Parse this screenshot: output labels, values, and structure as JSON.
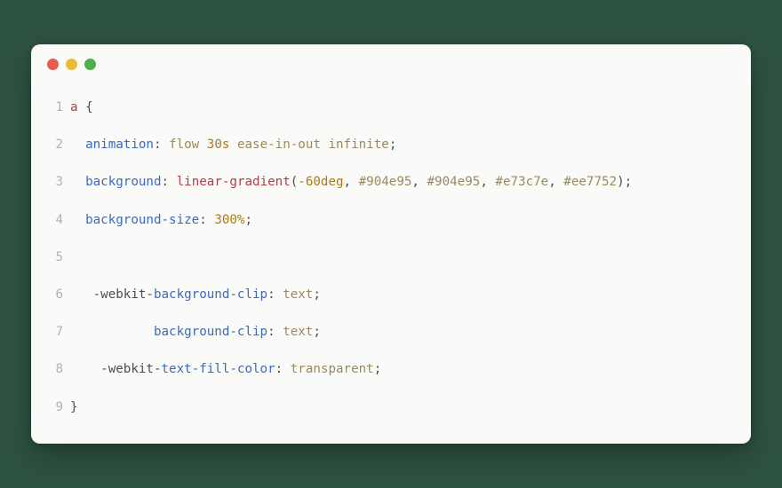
{
  "traffic_lights": {
    "red": "#e95b53",
    "yellow": "#e8bc3a",
    "green": "#51ae4c"
  },
  "code": {
    "lines": [
      {
        "n": "1",
        "tokens": [
          {
            "cls": "sel",
            "t": "a"
          },
          {
            "cls": "pln",
            "t": " "
          },
          {
            "cls": "op",
            "t": "{"
          }
        ]
      },
      {
        "n": "2",
        "tokens": [
          {
            "cls": "pln",
            "t": "  "
          },
          {
            "cls": "prop",
            "t": "animation"
          },
          {
            "cls": "op",
            "t": ":"
          },
          {
            "cls": "pln",
            "t": " "
          },
          {
            "cls": "kw",
            "t": "flow"
          },
          {
            "cls": "pln",
            "t": " "
          },
          {
            "cls": "num",
            "t": "30s"
          },
          {
            "cls": "pln",
            "t": " "
          },
          {
            "cls": "kw",
            "t": "ease-in-out"
          },
          {
            "cls": "pln",
            "t": " "
          },
          {
            "cls": "kw",
            "t": "infinite"
          },
          {
            "cls": "op",
            "t": ";"
          }
        ]
      },
      {
        "n": "3",
        "tokens": [
          {
            "cls": "pln",
            "t": "  "
          },
          {
            "cls": "prop",
            "t": "background"
          },
          {
            "cls": "op",
            "t": ":"
          },
          {
            "cls": "pln",
            "t": " "
          },
          {
            "cls": "func",
            "t": "linear-gradient"
          },
          {
            "cls": "op",
            "t": "("
          },
          {
            "cls": "num",
            "t": "-60deg"
          },
          {
            "cls": "op",
            "t": ","
          },
          {
            "cls": "pln",
            "t": " "
          },
          {
            "cls": "str",
            "t": "#904e95"
          },
          {
            "cls": "op",
            "t": ","
          },
          {
            "cls": "pln",
            "t": " "
          },
          {
            "cls": "str",
            "t": "#904e95"
          },
          {
            "cls": "op",
            "t": ","
          },
          {
            "cls": "pln",
            "t": " "
          },
          {
            "cls": "str",
            "t": "#e73c7e"
          },
          {
            "cls": "op",
            "t": ","
          },
          {
            "cls": "pln",
            "t": " "
          },
          {
            "cls": "str",
            "t": "#ee7752"
          },
          {
            "cls": "op",
            "t": ")"
          },
          {
            "cls": "op",
            "t": ";"
          }
        ]
      },
      {
        "n": "4",
        "tokens": [
          {
            "cls": "pln",
            "t": "  "
          },
          {
            "cls": "prop",
            "t": "background-size"
          },
          {
            "cls": "op",
            "t": ":"
          },
          {
            "cls": "pln",
            "t": " "
          },
          {
            "cls": "num",
            "t": "300%"
          },
          {
            "cls": "op",
            "t": ";"
          }
        ]
      },
      {
        "n": "5",
        "tokens": [
          {
            "cls": "pln",
            "t": " "
          }
        ]
      },
      {
        "n": "6",
        "tokens": [
          {
            "cls": "pln",
            "t": "   "
          },
          {
            "cls": "op",
            "t": "-"
          },
          {
            "cls": "pln",
            "t": "webkit-"
          },
          {
            "cls": "prop",
            "t": "background-clip"
          },
          {
            "cls": "op",
            "t": ":"
          },
          {
            "cls": "pln",
            "t": " "
          },
          {
            "cls": "kw",
            "t": "text"
          },
          {
            "cls": "op",
            "t": ";"
          }
        ]
      },
      {
        "n": "7",
        "tokens": [
          {
            "cls": "pln",
            "t": "           "
          },
          {
            "cls": "prop",
            "t": "background-clip"
          },
          {
            "cls": "op",
            "t": ":"
          },
          {
            "cls": "pln",
            "t": " "
          },
          {
            "cls": "kw",
            "t": "text"
          },
          {
            "cls": "op",
            "t": ";"
          }
        ]
      },
      {
        "n": "8",
        "tokens": [
          {
            "cls": "pln",
            "t": "    "
          },
          {
            "cls": "op",
            "t": "-"
          },
          {
            "cls": "pln",
            "t": "webkit-"
          },
          {
            "cls": "prop",
            "t": "text-fill-color"
          },
          {
            "cls": "op",
            "t": ":"
          },
          {
            "cls": "pln",
            "t": " "
          },
          {
            "cls": "kw",
            "t": "transparent"
          },
          {
            "cls": "op",
            "t": ";"
          }
        ]
      },
      {
        "n": "9",
        "tokens": [
          {
            "cls": "op",
            "t": "}"
          }
        ]
      }
    ]
  }
}
